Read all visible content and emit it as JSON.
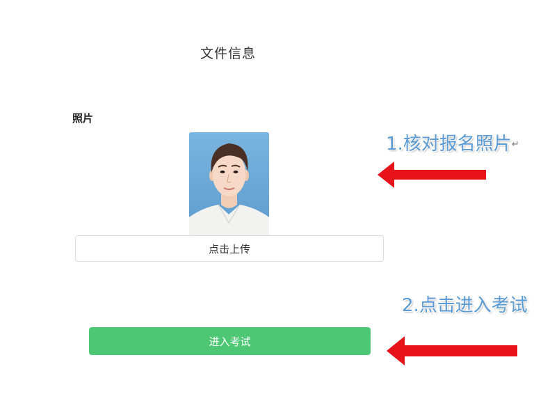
{
  "page": {
    "title": "文件信息",
    "photo_section_label": "照片"
  },
  "photo": {
    "icon": "portrait-photo"
  },
  "buttons": {
    "upload_label": "点击上传",
    "enter_exam_label": "进入考试",
    "enter_exam_color": "#4ec775"
  },
  "annotations": {
    "step1": "1.核对报名照片",
    "step1_mark": "↵",
    "step2": "2.点击进入考试",
    "text_color": "#5b9bd5",
    "arrow_color": "#e8121a"
  }
}
